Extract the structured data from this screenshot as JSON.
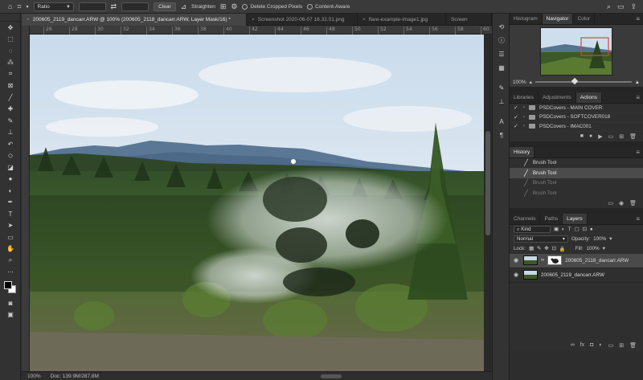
{
  "options_bar": {
    "ratio_label": "Ratio",
    "clear_label": "Clear",
    "straighten_label": "Straighten",
    "delete_cropped_label": "Delete Cropped Pixels",
    "content_aware_label": "Content-Aware"
  },
  "tabs": [
    {
      "label": "200605_2119_dancarr.ARW @ 100% (200605_2118_dancarr.ARW, Layer Mask/16) *",
      "close": "×"
    },
    {
      "label": "Screenshot 2020-06-07 16.32.01.png",
      "close": "×"
    },
    {
      "label": "flare-example-image1.jpg",
      "close": "×"
    },
    {
      "label": "Screen",
      "close": ""
    }
  ],
  "ruler_ticks": [
    "26",
    "28",
    "30",
    "32",
    "34",
    "36",
    "38",
    "40",
    "42",
    "44",
    "46",
    "48",
    "50",
    "52",
    "54",
    "56",
    "58",
    "60"
  ],
  "status": {
    "zoom": "100%",
    "doc": "Doc: 139.9M/287.8M"
  },
  "panels": {
    "nav_tabs": [
      "Histogram",
      "Navigator",
      "Color"
    ],
    "nav_zoom": "100%",
    "mid_tabs": [
      "Libraries",
      "Adjustments",
      "Actions"
    ],
    "actions": [
      {
        "label": "PSDCovers - MAIN COVER"
      },
      {
        "label": "PSDCovers - SOFTCOVER018"
      },
      {
        "label": "PSDCovers - IMAC001"
      }
    ],
    "history_title": "History",
    "history": [
      {
        "label": "Brush Tool",
        "state": "normal"
      },
      {
        "label": "Brush Tool",
        "state": "active"
      },
      {
        "label": "Brush Tool",
        "state": "dim"
      },
      {
        "label": "Brush Tool",
        "state": "dim"
      }
    ],
    "layers_tabs": [
      "Channels",
      "Paths",
      "Layers"
    ],
    "kind_label": "Kind",
    "blend_mode": "Normal",
    "opacity_label": "Opacity:",
    "opacity_value": "100%",
    "lock_label": "Lock:",
    "fill_label": "Fill:",
    "fill_value": "100%",
    "layers": [
      {
        "name": "200605_2118_dancarr.ARW",
        "has_mask": true,
        "active": true
      },
      {
        "name": "200605_2119_dancarr.ARW",
        "has_mask": false,
        "active": false
      }
    ]
  },
  "colors": {
    "sky": "#dfe7ee",
    "mountains": "#52718f",
    "forest": "#2c4222",
    "accent_red": "#d8483b"
  }
}
